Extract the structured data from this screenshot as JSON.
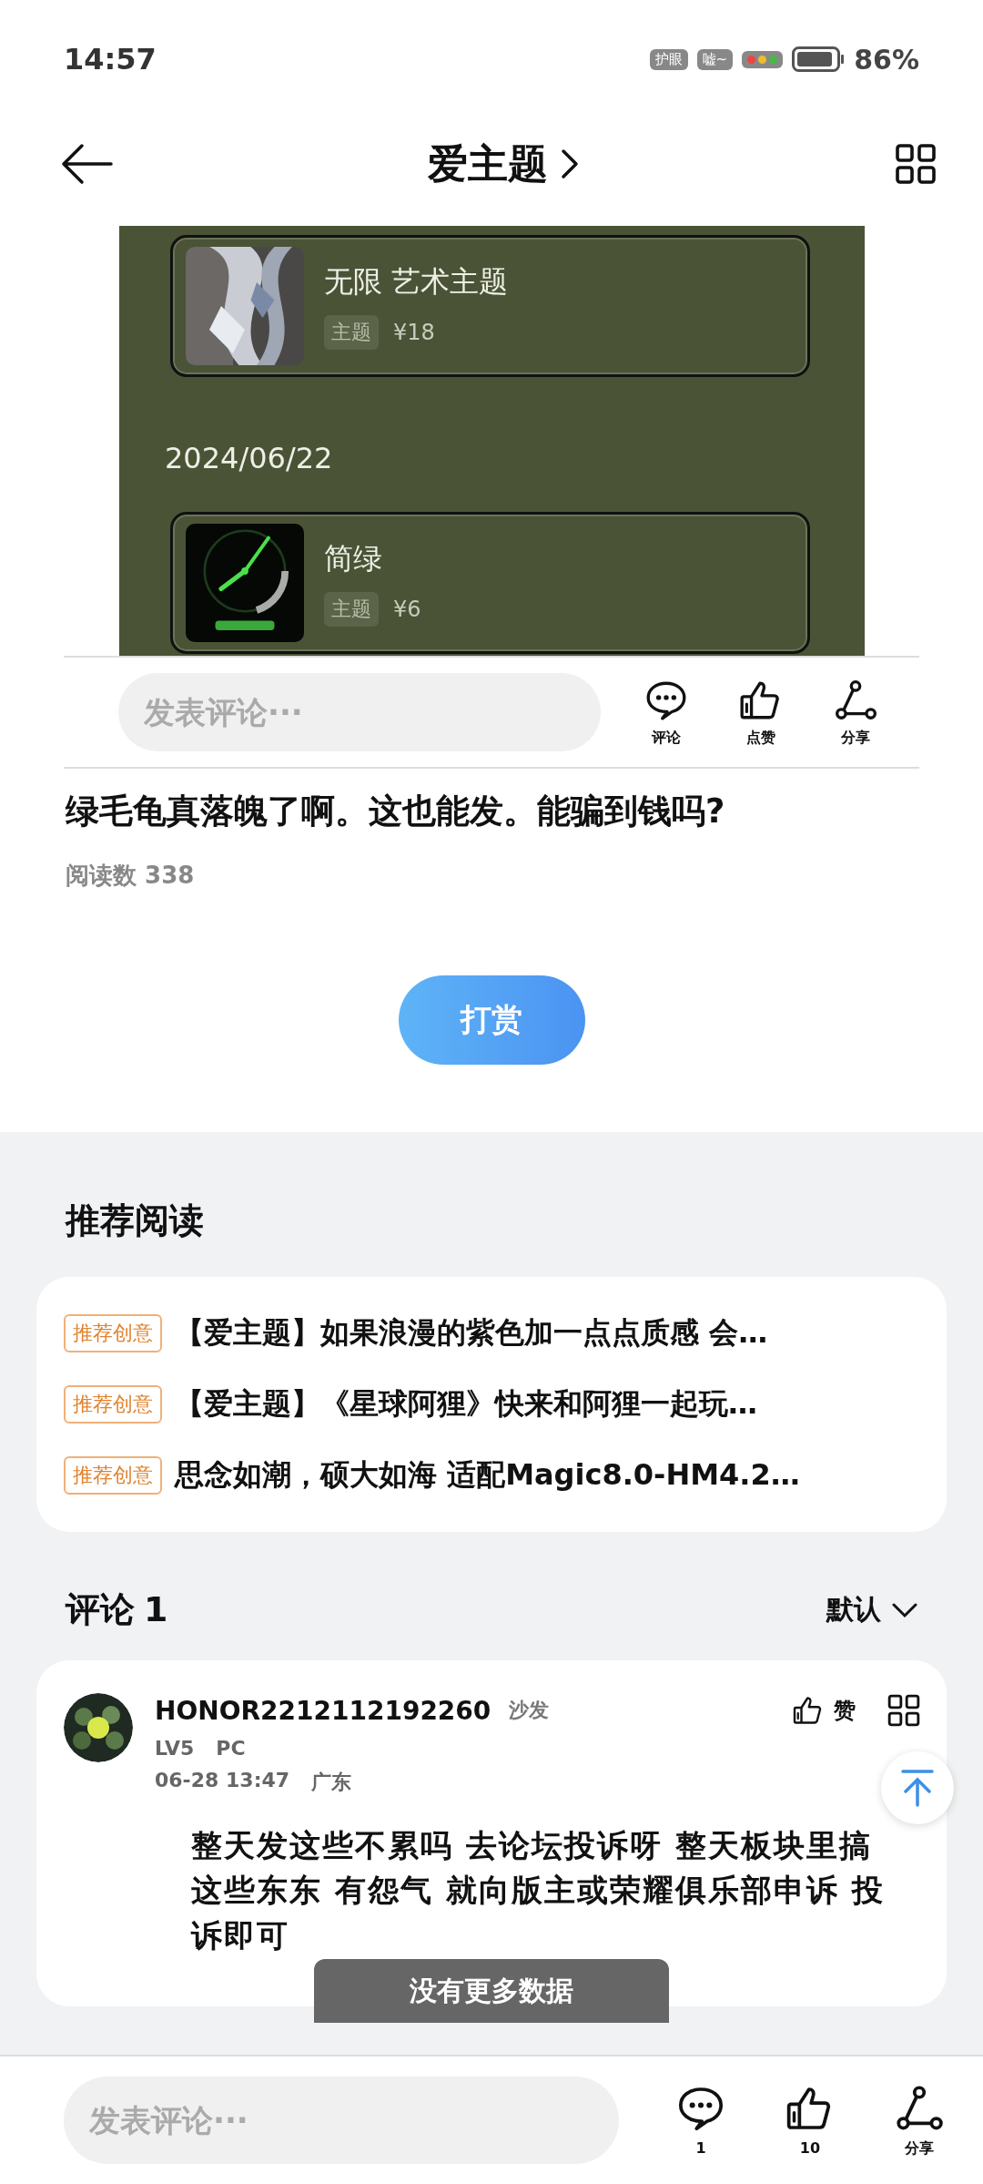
{
  "status_bar": {
    "time": "14:57",
    "badges": [
      "护眼",
      "嘘~"
    ],
    "battery": "86%"
  },
  "header": {
    "title": "爱主题"
  },
  "post_image": {
    "entries": [
      {
        "kind": "theme",
        "name": "无限 艺术主题",
        "tag": "主题",
        "price": "¥18"
      },
      {
        "kind": "date",
        "text": "2024/06/22"
      },
      {
        "kind": "theme",
        "name": "简绿",
        "tag": "主题",
        "price": "¥6"
      }
    ]
  },
  "action_bar": {
    "placeholder": "发表评论···",
    "actions": [
      {
        "kind": "comment",
        "label": "评论"
      },
      {
        "kind": "like",
        "label": "点赞"
      },
      {
        "kind": "share",
        "label": "分享"
      }
    ]
  },
  "post": {
    "title": "绿毛龟真落魄了啊。这也能发。能骗到钱吗?",
    "reads": "阅读数 338",
    "reward_button": "打赏"
  },
  "recommended": {
    "title": "推荐阅读",
    "items": [
      {
        "tag": "推荐创意",
        "title": "【爱主题】如果浪漫的紫色加一点点质感 会…"
      },
      {
        "tag": "推荐创意",
        "title": "【爱主题】《星球阿狸》快来和阿狸一起玩…"
      },
      {
        "tag": "推荐创意",
        "title": "思念如潮，硕大如海 适配Magic8.0-HM4.2…"
      }
    ]
  },
  "comments": {
    "title": "评论",
    "count": "1",
    "sort": "默认",
    "items": [
      {
        "user": "HONOR2212112192260",
        "badge": "沙发",
        "level": "LV5",
        "device": "PC",
        "time": "06-28 13:47",
        "location": "广东",
        "like_label": "赞",
        "text": "整天发这些不累吗  去论坛投诉呀  整天板块里搞这些东东 有怨气 就向版主或荣耀俱乐部申诉 投诉即可"
      }
    ]
  },
  "toast": "没有更多数据",
  "bottom_bar": {
    "placeholder": "发表评论···",
    "actions": [
      {
        "kind": "comment",
        "label": "1"
      },
      {
        "kind": "like",
        "label": "10"
      },
      {
        "kind": "share",
        "label": "分享"
      }
    ]
  }
}
